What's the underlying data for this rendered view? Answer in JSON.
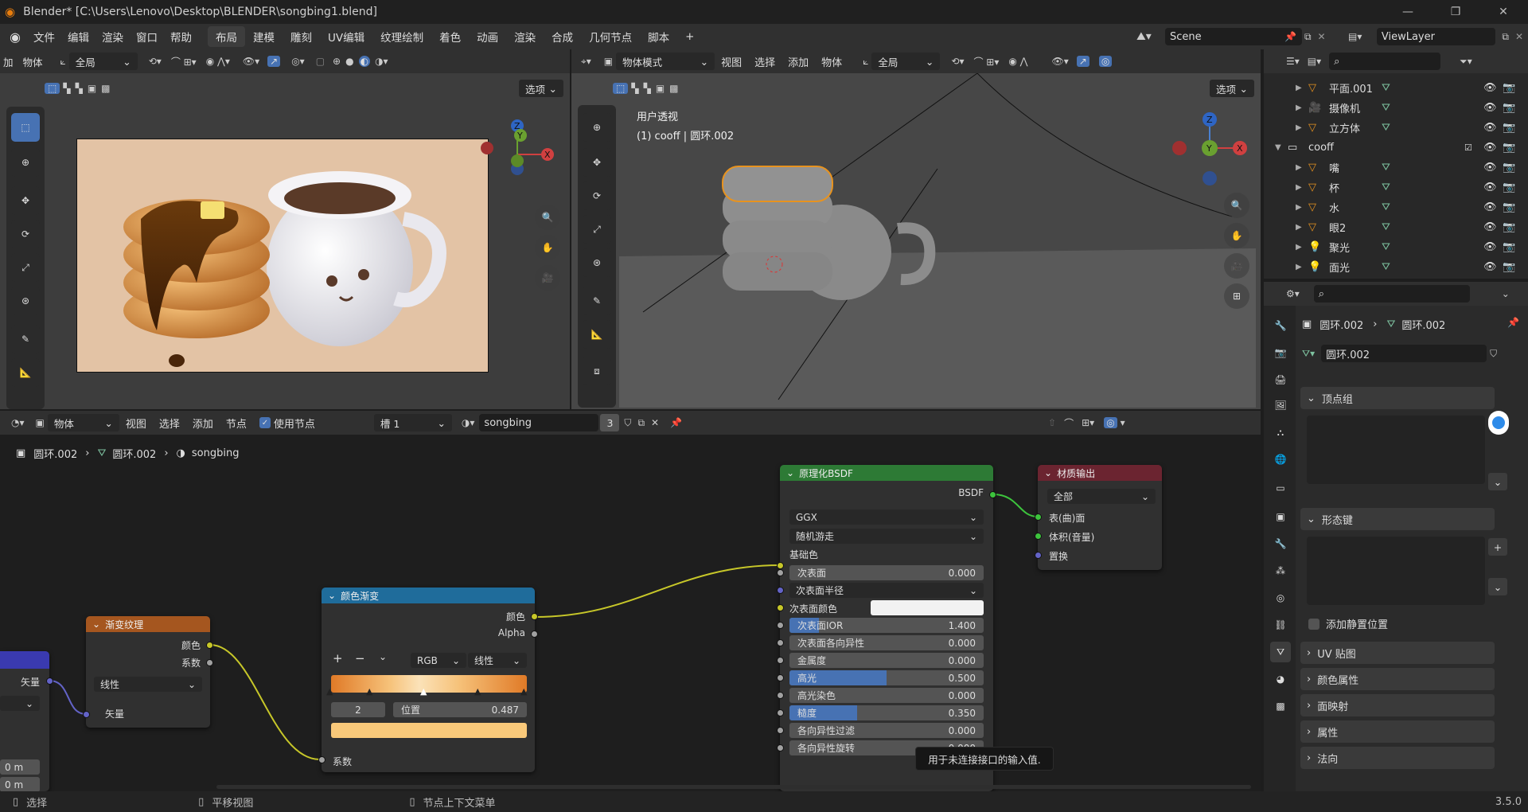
{
  "window": {
    "title": "Blender* [C:\\Users\\Lenovo\\Desktop\\BLENDER\\songbing1.blend]",
    "minimize": "—",
    "maximize": "❐",
    "close": "✕"
  },
  "menu": [
    "文件",
    "编辑",
    "渲染",
    "窗口",
    "帮助"
  ],
  "workspaces": [
    "布局",
    "建模",
    "雕刻",
    "UV编辑",
    "纹理绘制",
    "着色",
    "动画",
    "渲染",
    "合成",
    "几何节点",
    "脚本"
  ],
  "workspace_add": "+",
  "scene": {
    "name": "Scene"
  },
  "viewlayer": {
    "name": "ViewLayer"
  },
  "left_view": {
    "menu_add": "加",
    "menu_object": "物体",
    "transform": "全局",
    "options": "选项"
  },
  "right_view": {
    "mode": "物体模式",
    "menus": [
      "视图",
      "选择",
      "添加",
      "物体"
    ],
    "transform": "全局",
    "options": "选项",
    "overlay_title": "用户透视",
    "overlay_sub": "(1) cooff | 圆环.002"
  },
  "gizmo": {
    "x": "X",
    "y": "Y",
    "z": "Z"
  },
  "node_editor": {
    "header": {
      "object": "物体",
      "menus": [
        "视图",
        "选择",
        "添加",
        "节点"
      ],
      "use_nodes": "使用节点",
      "slot": "槽 1",
      "material": "songbing",
      "users": "3"
    },
    "breadcrumb": [
      "圆环.002",
      "圆环.002",
      "songbing"
    ],
    "tooltip": "用于未连接接口的输入值."
  },
  "nodes": {
    "left_partial": {
      "socket_vector": "矢量",
      "dist1": "0 m",
      "dist2": "0 m"
    },
    "gradient": {
      "title": "渐变纹理",
      "out_color": "颜色",
      "out_fac": "系数",
      "type": "线性",
      "in_vector": "矢量"
    },
    "colorramp": {
      "title": "颜色渐变",
      "out_color": "颜色",
      "out_alpha": "Alpha",
      "plus": "+",
      "minus": "−",
      "mode": "RGB",
      "interp": "线性",
      "index": "2",
      "pos_label": "位置",
      "pos_value": "0.487",
      "in_fac": "系数",
      "ramp_color": "#f9c97a"
    },
    "bsdf": {
      "title": "原理化BSDF",
      "out": "BSDF",
      "distribution": "GGX",
      "ss_method": "随机游走",
      "base_color": "基础色",
      "rows": [
        {
          "label": "次表面",
          "value": "0.000",
          "fill": 0
        },
        {
          "label": "次表面IOR",
          "value": "1.400",
          "fill": 0.15
        },
        {
          "label": "次表面各向异性",
          "value": "0.000",
          "fill": 0
        },
        {
          "label": "金属度",
          "value": "0.000",
          "fill": 0
        },
        {
          "label": "高光",
          "value": "0.500",
          "fill": 0.5
        },
        {
          "label": "高光染色",
          "value": "0.000",
          "fill": 0
        },
        {
          "label": "糙度",
          "value": "0.350",
          "fill": 0.35
        },
        {
          "label": "各向异性过滤",
          "value": "0.000",
          "fill": 0
        },
        {
          "label": "各向异性旋转",
          "value": "0.000",
          "fill": 0
        }
      ],
      "ss_radius": "次表面半径",
      "ss_color": "次表面颜色"
    },
    "output": {
      "title": "材质输出",
      "target": "全部",
      "in_surface": "表(曲)面",
      "in_volume": "体积(音量)",
      "in_disp": "置换"
    }
  },
  "outliner": {
    "items": [
      {
        "name": "平面.001",
        "icon": "mesh"
      },
      {
        "name": "摄像机",
        "icon": "camera"
      },
      {
        "name": "立方体",
        "icon": "mesh"
      },
      {
        "name": "cooff",
        "icon": "collection"
      },
      {
        "name": "嘴",
        "icon": "mesh"
      },
      {
        "name": "杯",
        "icon": "mesh"
      },
      {
        "name": "水",
        "icon": "mesh"
      },
      {
        "name": "眼2",
        "icon": "mesh"
      },
      {
        "name": "聚光",
        "icon": "light"
      },
      {
        "name": "面光",
        "icon": "light"
      }
    ]
  },
  "properties": {
    "breadcrumb1": "圆环.002",
    "breadcrumb2": "圆环.002",
    "data_name": "圆环.002",
    "sections": {
      "vertex_groups": "顶点组",
      "shape_keys": "形态键",
      "add_rest": "添加静置位置",
      "uv": "UV 贴图",
      "color_attr": "颜色属性",
      "face_maps": "面映射",
      "attributes": "属性",
      "normals": "法向"
    }
  },
  "status": {
    "select": "选择",
    "pan": "平移视图",
    "context": "节点上下文菜单",
    "version": "3.5.0"
  },
  "colors": {
    "accent": "#4772b3",
    "bsdf_head": "#2d7a35",
    "texture_head": "#a5561f",
    "converter_head": "#1f6c9b",
    "output_head": "#6b2430",
    "select_outline": "#e8931f"
  }
}
